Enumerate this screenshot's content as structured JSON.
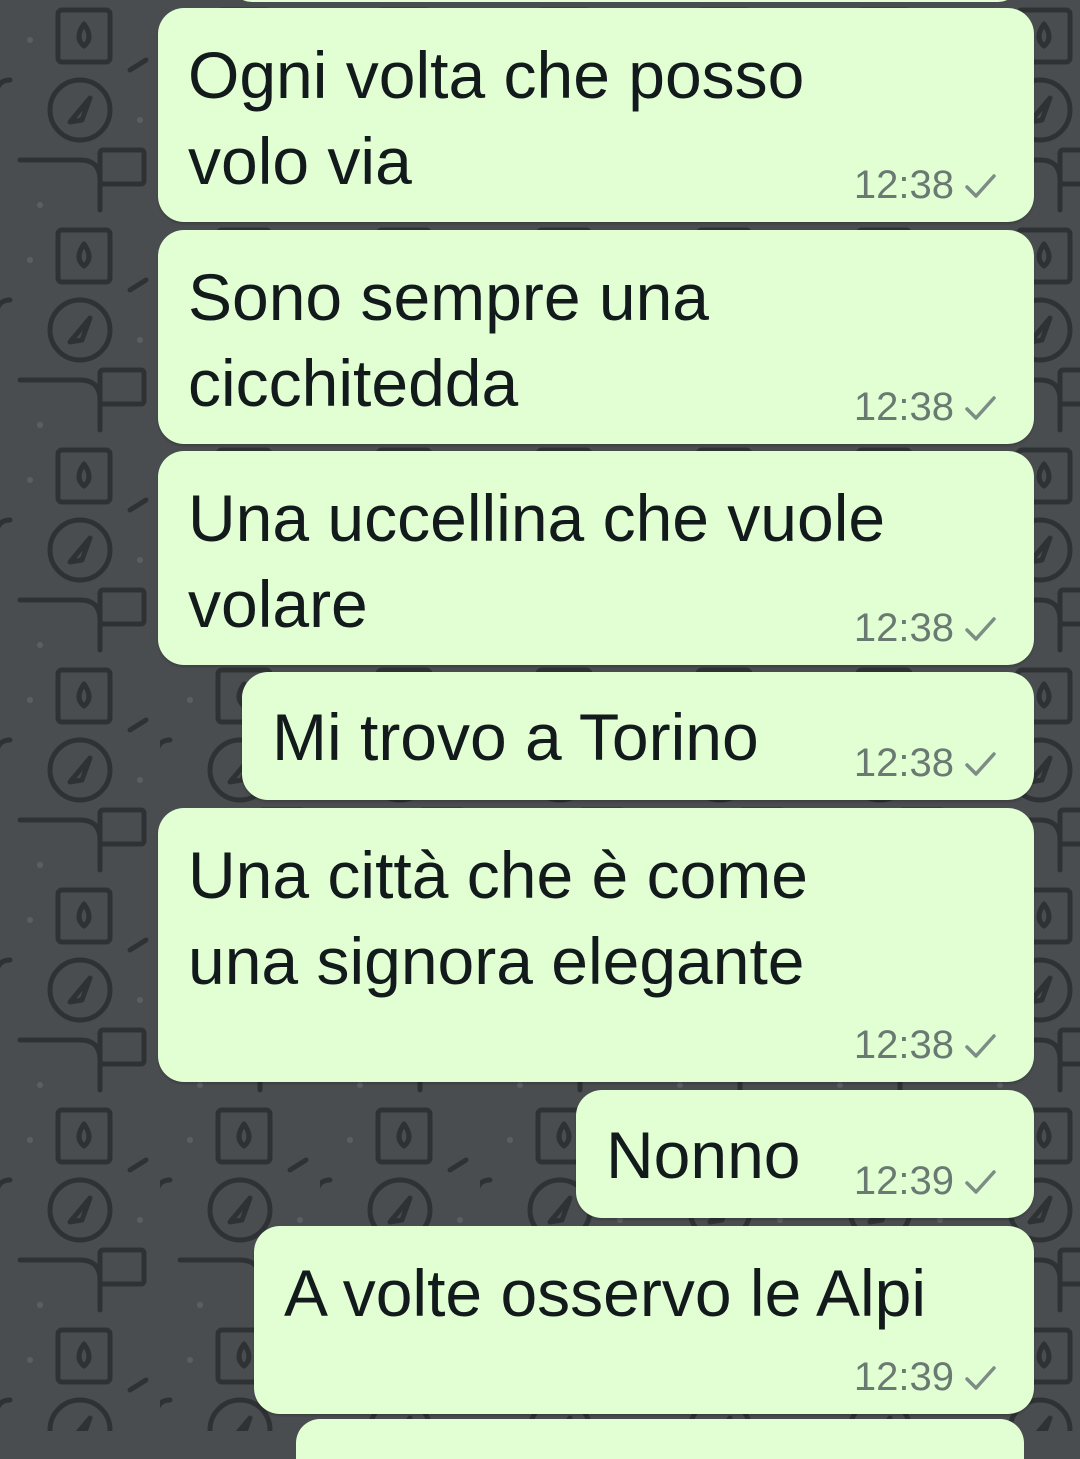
{
  "colors": {
    "bubble_outgoing": "#e2ffd4",
    "wallpaper": "#4a4d50",
    "text": "#121a1c",
    "meta": "#6a7a72"
  },
  "messages": [
    {
      "text_lines": [
        "Ogni volta che posso",
        "volo via"
      ],
      "time": "12:38",
      "status_icon": "single-check-icon"
    },
    {
      "text_lines": [
        "Sono sempre una",
        "cicchitedda"
      ],
      "time": "12:38",
      "status_icon": "single-check-icon"
    },
    {
      "text_lines": [
        "Una uccellina che vuole",
        "volare"
      ],
      "time": "12:38",
      "status_icon": "single-check-icon"
    },
    {
      "text_lines": [
        "Mi trovo a Torino"
      ],
      "time": "12:38",
      "status_icon": "single-check-icon"
    },
    {
      "text_lines": [
        "Una città che è come",
        "una signora elegante"
      ],
      "time": "12:38",
      "status_icon": "single-check-icon"
    },
    {
      "text_lines": [
        "Nonno"
      ],
      "time": "12:39",
      "status_icon": "single-check-icon"
    },
    {
      "text_lines": [
        "A volte osservo le Alpi"
      ],
      "time": "12:39",
      "status_icon": "single-check-icon"
    }
  ]
}
